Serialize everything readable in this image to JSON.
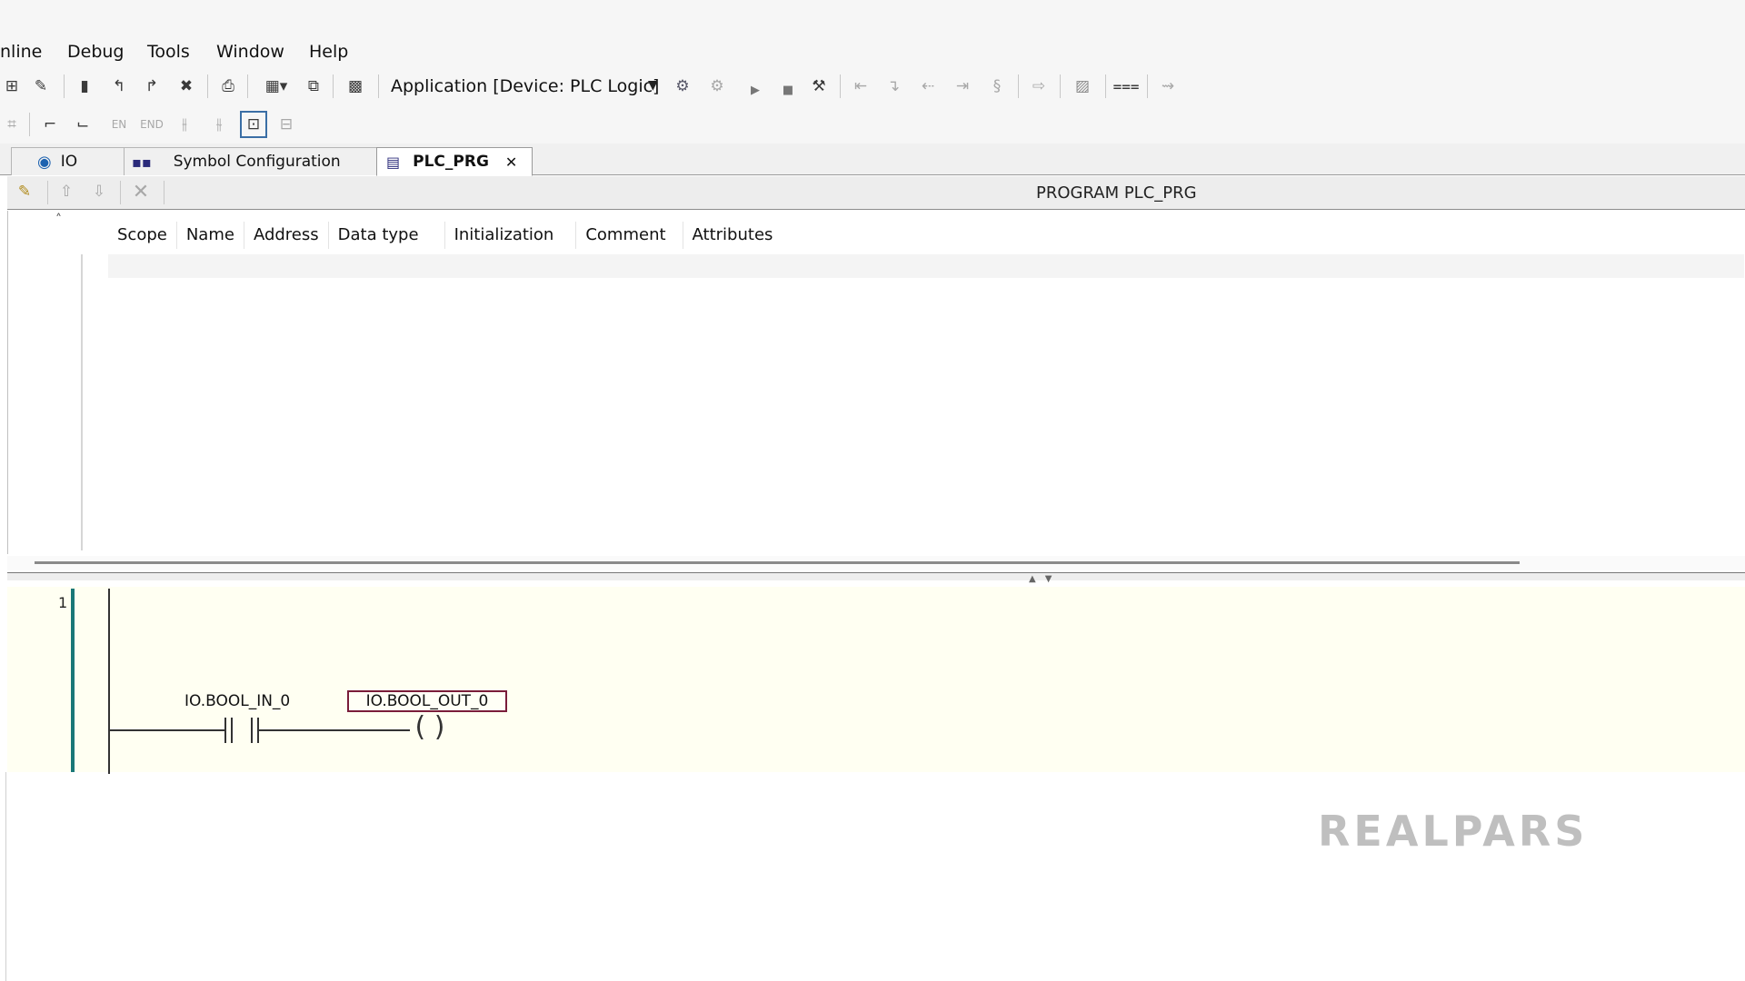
{
  "menu": {
    "items": [
      "nline",
      "Debug",
      "Tools",
      "Window",
      "Help"
    ]
  },
  "toolbar": {
    "application_selector": "Application [Device: PLC Logic]",
    "icons_row1": [
      "open-icon",
      "bookmark-icon",
      "bookmark-next-icon",
      "bookmark-prev-icon",
      "bookmark-clear-icon",
      "print-icon",
      "watch-list-icon",
      "export-icon",
      "device-icon",
      "login-icon",
      "logout-icon",
      "run-icon",
      "stop-icon",
      "reset-icon",
      "step-over-icon",
      "step-into-icon",
      "step-out-icon",
      "run-to-cursor-icon",
      "set-next-statement-icon",
      "show-current-statement-icon",
      "write-values-icon",
      "force-values-icon",
      "toggle-breakpoint-icon"
    ],
    "icons_row2": [
      "cut-icon",
      "rising-edge-icon",
      "falling-edge-icon",
      "en-icon",
      "end-icon",
      "insert-contact-icon",
      "insert-negated-contact-icon",
      "box-icon",
      "network-icon"
    ],
    "row2_text": {
      "en": "EN",
      "end": "END"
    }
  },
  "tabs": [
    {
      "label": "IO",
      "icon": "globe-icon",
      "active": false
    },
    {
      "label": "Symbol Configuration",
      "icon": "symbol-config-icon",
      "active": false
    },
    {
      "label": "PLC_PRG",
      "icon": "program-icon",
      "active": true,
      "close": "✕"
    }
  ],
  "declaration": {
    "title": "PROGRAM PLC_PRG",
    "columns": [
      "Scope",
      "Name",
      "Address",
      "Data type",
      "Initialization",
      "Comment",
      "Attributes"
    ]
  },
  "ladder": {
    "row_number": "1",
    "contact_label": "IO.BOOL_IN_0",
    "coil_label": "IO.BOOL_OUT_0",
    "coil_symbol": "( )"
  },
  "watermark": "REALPARS"
}
